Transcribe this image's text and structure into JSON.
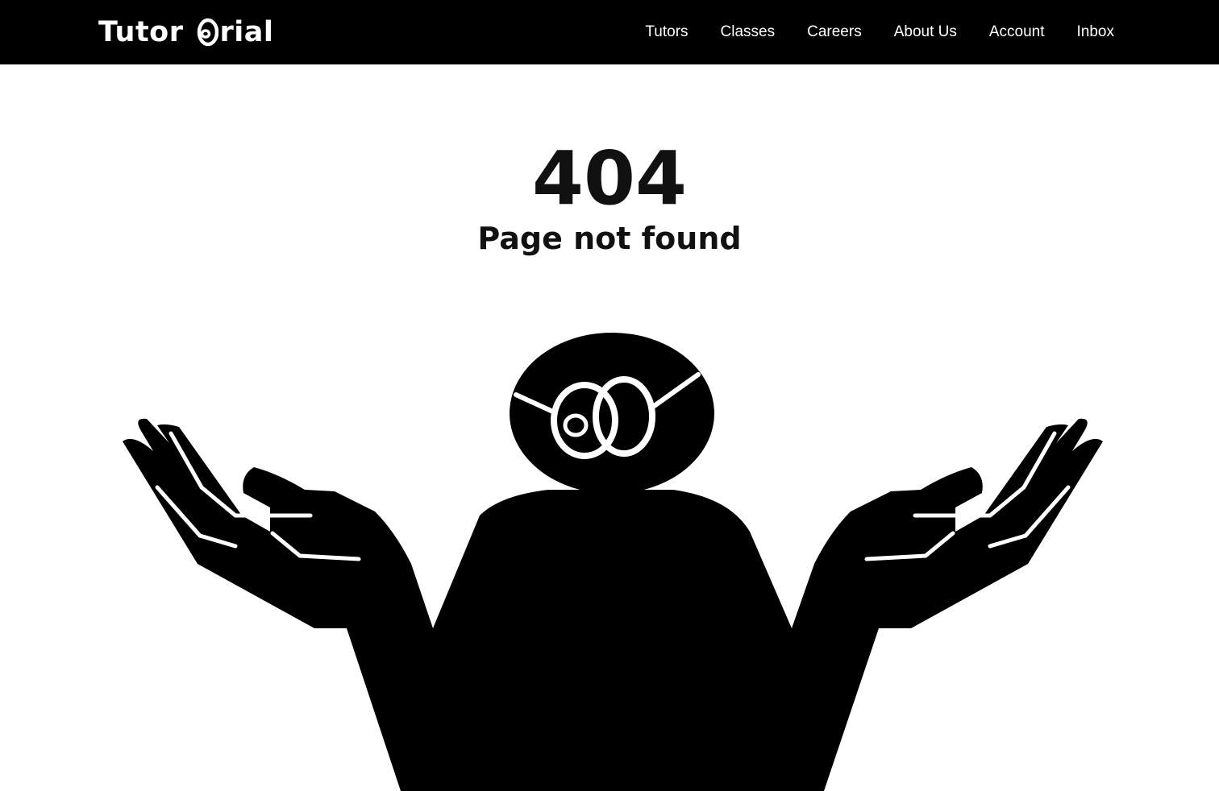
{
  "header": {
    "logo_text_left": "Tutor",
    "logo_text_right": "rial",
    "logo_icon": "tutorial-o-mark-icon",
    "nav": [
      {
        "label": "Tutors"
      },
      {
        "label": "Classes"
      },
      {
        "label": "Careers"
      },
      {
        "label": "About Us"
      },
      {
        "label": "Account"
      },
      {
        "label": "Inbox"
      }
    ]
  },
  "main": {
    "error_code": "404",
    "error_message": "Page not found",
    "illustration": "shrugging-figure-with-glasses"
  },
  "colors": {
    "header_background": "#000000",
    "header_text": "#ffffff",
    "page_background": "#ffffff",
    "text": "#111111",
    "illustration": "#000000"
  }
}
